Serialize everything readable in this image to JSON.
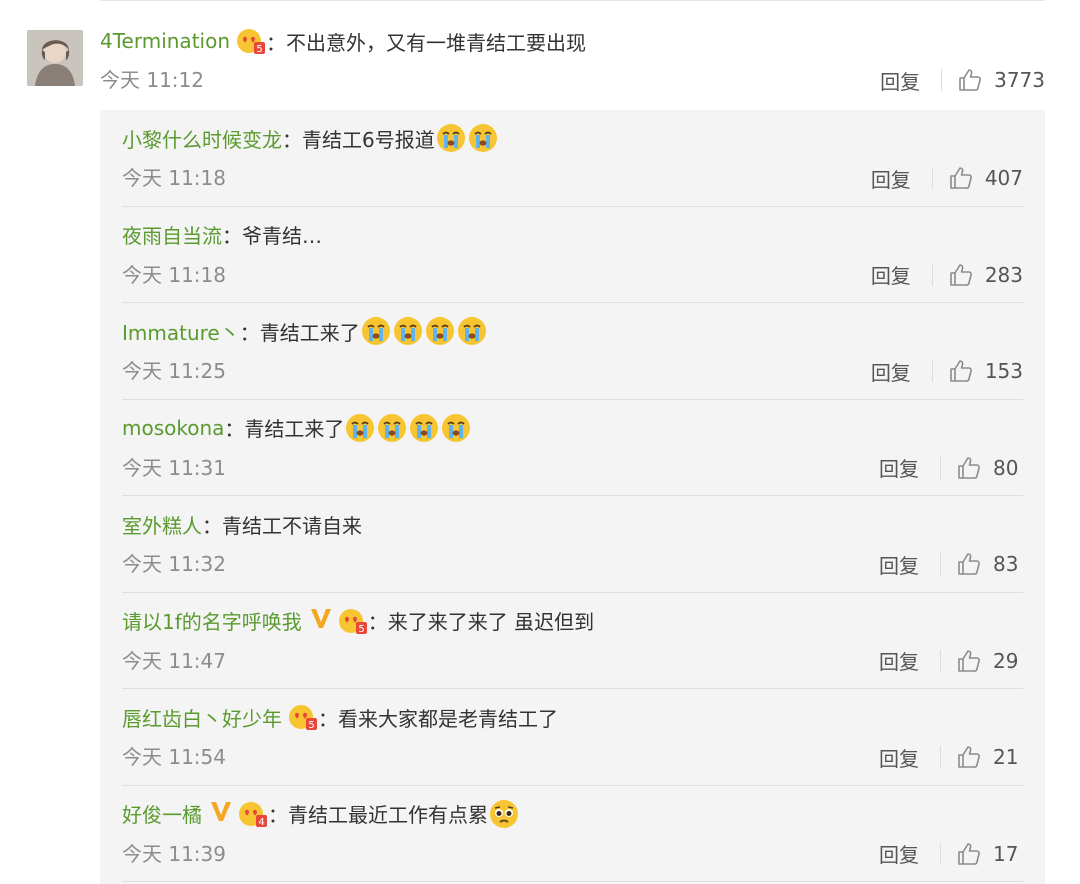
{
  "main_comment": {
    "username": "4Termination",
    "separator": "：",
    "text": "不出意外，又有一堆青结工要出现",
    "time": "今天 11:12",
    "reply_label": "回复",
    "likes": "3773",
    "level_badge": "5"
  },
  "replies": [
    {
      "username": "小黎什么时候变龙",
      "separator": "：",
      "text": "青结工6号报道",
      "emojis": [
        "crying-emoji",
        "crying-emoji"
      ],
      "vip": false,
      "level": "",
      "time": "今天 11:18",
      "reply_label": "回复",
      "likes": "407"
    },
    {
      "username": "夜雨自当流",
      "separator": "：",
      "text": "爷青结…",
      "emojis": [],
      "vip": false,
      "level": "",
      "time": "今天 11:18",
      "reply_label": "回复",
      "likes": "283"
    },
    {
      "username": "Immature丶",
      "separator": "：",
      "text": "青结工来了",
      "emojis": [
        "crying-emoji",
        "crying-emoji",
        "crying-emoji",
        "crying-emoji"
      ],
      "vip": false,
      "level": "",
      "time": "今天 11:25",
      "reply_label": "回复",
      "likes": "153"
    },
    {
      "username": "mosokona",
      "separator": "：",
      "text": "青结工来了",
      "emojis": [
        "crying-emoji",
        "crying-emoji",
        "crying-emoji",
        "crying-emoji"
      ],
      "vip": false,
      "level": "",
      "time": "今天 11:31",
      "reply_label": "回复",
      "likes": "80"
    },
    {
      "username": "室外糕人",
      "separator": "：",
      "text": "青结工不请自来",
      "emojis": [],
      "vip": false,
      "level": "",
      "time": "今天 11:32",
      "reply_label": "回复",
      "likes": "83"
    },
    {
      "username": "请以1f的名字呼唤我",
      "separator": "：",
      "text": "来了来了来了 虽迟但到",
      "emojis": [],
      "vip": true,
      "level": "5",
      "time": "今天 11:47",
      "reply_label": "回复",
      "likes": "29"
    },
    {
      "username": "唇红齿白丶好少年",
      "separator": "：",
      "text": "看来大家都是老青结工了",
      "emojis": [],
      "vip": false,
      "level": "5",
      "time": "今天 11:54",
      "reply_label": "回复",
      "likes": "21"
    },
    {
      "username": "好俊一橘",
      "separator": "：",
      "text": "青结工最近工作有点累",
      "emojis": [
        "pleading-emoji"
      ],
      "vip": true,
      "level": "4",
      "time": "今天 11:39",
      "reply_label": "回复",
      "likes": "17"
    }
  ],
  "colors": {
    "username": "#5a9a2f",
    "meta": "#8c8c8c",
    "reply_panel": "#f4f4f4",
    "vip": "#f5a623",
    "badge": "#e8473a"
  }
}
